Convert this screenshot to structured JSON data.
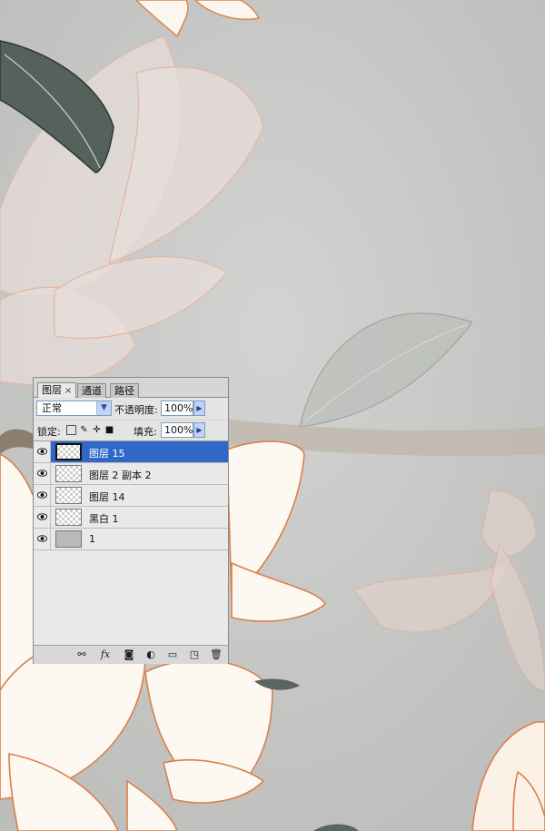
{
  "canvas": {
    "background_color": "#c9c9c7"
  },
  "panel": {
    "tabs": [
      {
        "label": "图层",
        "close": "×"
      },
      {
        "label": "通道"
      },
      {
        "label": "路径"
      }
    ],
    "blend_mode": "正常",
    "opacity_label": "不透明度:",
    "opacity_value": "100%",
    "lock_label": "锁定:",
    "fill_label": "填充:",
    "fill_value": "100%",
    "layers": [
      {
        "name": "图层 15",
        "selected": true,
        "visible": true,
        "thumb": "transparent"
      },
      {
        "name": "图层 2 副本 2",
        "selected": false,
        "visible": true,
        "thumb": "transparent"
      },
      {
        "name": "图层 14",
        "selected": false,
        "visible": true,
        "thumb": "transparent"
      },
      {
        "name": "黑白 1",
        "selected": false,
        "visible": true,
        "thumb": "transparent"
      },
      {
        "name": "1",
        "selected": false,
        "visible": true,
        "thumb": "solid"
      }
    ],
    "footer_icons": [
      "link-icon",
      "fx-icon",
      "mask-icon",
      "adjustment-icon",
      "folder-icon",
      "new-layer-icon",
      "trash-icon"
    ],
    "accent_color": "#3168c8"
  }
}
